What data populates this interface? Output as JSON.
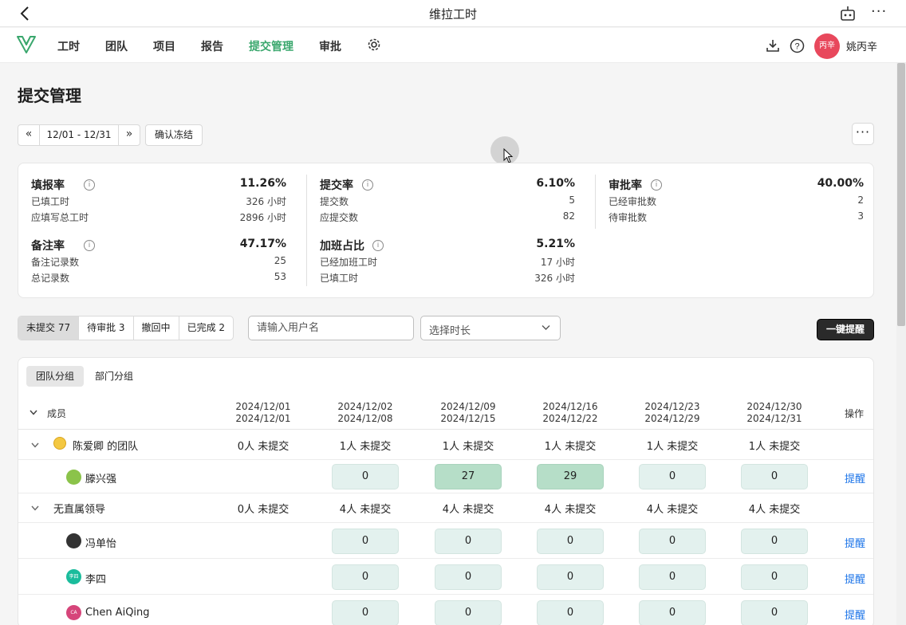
{
  "window": {
    "title": "维拉工时"
  },
  "nav": {
    "items": [
      {
        "label": "工时",
        "active": false
      },
      {
        "label": "团队",
        "active": false
      },
      {
        "label": "项目",
        "active": false
      },
      {
        "label": "报告",
        "active": false
      },
      {
        "label": "提交管理",
        "active": true
      },
      {
        "label": "审批",
        "active": false
      }
    ],
    "avatar_text": "丙辛",
    "user_name": "姚丙辛"
  },
  "page": {
    "title": "提交管理"
  },
  "toolbar": {
    "prev_label": "«",
    "date_range": "12/01 - 12/31",
    "next_label": "»",
    "confirm_label": "确认冻结",
    "more_label": "···"
  },
  "stats": {
    "fill_rate": {
      "label": "填报率",
      "value": "11.26%",
      "rows": [
        {
          "k": "已填工时",
          "v": "326 小时"
        },
        {
          "k": "应填写总工时",
          "v": "2896 小时"
        }
      ]
    },
    "submit_rate": {
      "label": "提交率",
      "value": "6.10%",
      "rows": [
        {
          "k": "提交数",
          "v": "5"
        },
        {
          "k": "应提交数",
          "v": "82"
        }
      ]
    },
    "approve_rate": {
      "label": "审批率",
      "value": "40.00%",
      "rows": [
        {
          "k": "已经审批数",
          "v": "2"
        },
        {
          "k": "待审批数",
          "v": "3"
        }
      ]
    },
    "note_rate": {
      "label": "备注率",
      "value": "47.17%",
      "rows": [
        {
          "k": "备注记录数",
          "v": "25"
        },
        {
          "k": "总记录数",
          "v": "53"
        }
      ]
    },
    "overtime_rate": {
      "label": "加班占比",
      "value": "5.21%",
      "rows": [
        {
          "k": "已经加班工时",
          "v": "17 小时"
        },
        {
          "k": "已填工时",
          "v": "326 小时"
        }
      ]
    }
  },
  "filters": {
    "segments": [
      "未提交 77",
      "待审批 3",
      "撤回中",
      "已完成 2"
    ],
    "search_placeholder": "请输入用户名",
    "duration_placeholder": "选择时长",
    "remind_all_label": "一键提醒"
  },
  "table": {
    "group_tabs": [
      "团队分组",
      "部门分组"
    ],
    "member_header": "成员",
    "ops_header": "操作",
    "periods": [
      {
        "start": "2024/12/01",
        "end": "2024/12/01"
      },
      {
        "start": "2024/12/02",
        "end": "2024/12/08"
      },
      {
        "start": "2024/12/09",
        "end": "2024/12/15"
      },
      {
        "start": "2024/12/16",
        "end": "2024/12/22"
      },
      {
        "start": "2024/12/23",
        "end": "2024/12/29"
      },
      {
        "start": "2024/12/30",
        "end": "2024/12/31"
      }
    ],
    "groups": [
      {
        "name": "陈爱卿 的团队",
        "counts": [
          "0人 未提交",
          "1人 未提交",
          "1人 未提交",
          "1人 未提交",
          "1人 未提交",
          "1人 未提交"
        ],
        "members": [
          {
            "name": "滕兴强",
            "avatar_color": "#8bc34a",
            "avatar_text": "",
            "hours": [
              null,
              "0",
              "27",
              "29",
              "0",
              "0"
            ],
            "remind": "提醒"
          }
        ]
      },
      {
        "name": "无直属领导",
        "counts": [
          "0人 未提交",
          "4人 未提交",
          "4人 未提交",
          "4人 未提交",
          "4人 未提交",
          "4人 未提交"
        ],
        "members": [
          {
            "name": "冯单怡",
            "avatar_color": "#333333",
            "avatar_text": "",
            "hours": [
              null,
              "0",
              "0",
              "0",
              "0",
              "0"
            ],
            "remind": "提醒"
          },
          {
            "name": "李四",
            "avatar_color": "#1abc9c",
            "avatar_text": "李四",
            "hours": [
              null,
              "0",
              "0",
              "0",
              "0",
              "0"
            ],
            "remind": "提醒"
          },
          {
            "name": "Chen AiQing",
            "avatar_color": "#d6457a",
            "avatar_text": "CA",
            "hours": [
              null,
              "0",
              "0",
              "0",
              "0",
              "0"
            ],
            "remind": "提醒"
          }
        ]
      }
    ]
  }
}
